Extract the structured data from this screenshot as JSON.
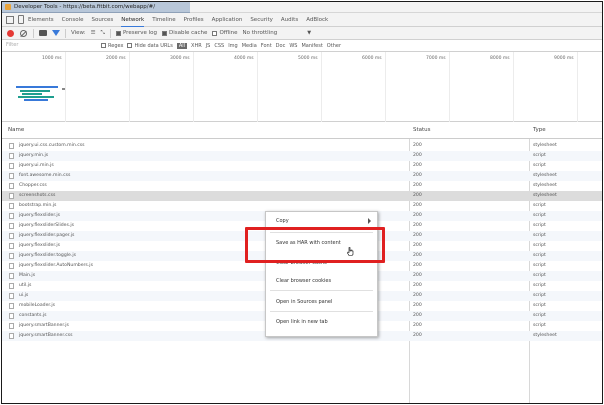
{
  "window": {
    "title": "Developer Tools - https://beta.fitbit.com/webapp/#/"
  },
  "tabs": [
    "Elements",
    "Console",
    "Sources",
    "Network",
    "Timeline",
    "Profiles",
    "Application",
    "Security",
    "Audits",
    "AdBlock"
  ],
  "active_tab": "Network",
  "controls": {
    "view_label": "View:",
    "preserve_log": "Preserve log",
    "disable_cache": "Disable cache",
    "offline": "Offline",
    "throttling": "No throttling"
  },
  "filter": {
    "placeholder": "Filter",
    "regex": "Regex",
    "hide_data_urls": "Hide data URLs",
    "types": [
      "All",
      "XHR",
      "JS",
      "CSS",
      "Img",
      "Media",
      "Font",
      "Doc",
      "WS",
      "Manifest",
      "Other"
    ]
  },
  "timeline": {
    "ticks": [
      "1000 ms",
      "2000 ms",
      "3000 ms",
      "4000 ms",
      "5000 ms",
      "6000 ms",
      "7000 ms",
      "8000 ms",
      "9000 ms"
    ]
  },
  "table": {
    "headers": {
      "name": "Name",
      "status": "Status",
      "type": "Type"
    },
    "rows": [
      {
        "name": "jquery.ui.css.custom.min.css",
        "status": "200",
        "type": "stylesheet"
      },
      {
        "name": "jquery.min.js",
        "status": "200",
        "type": "script"
      },
      {
        "name": "jquery.ui.min.js",
        "status": "200",
        "type": "script"
      },
      {
        "name": "font.awesome.min.css",
        "status": "200",
        "type": "stylesheet"
      },
      {
        "name": "Chopper.css",
        "status": "200",
        "type": "stylesheet"
      },
      {
        "name": "screenshots.css",
        "status": "200",
        "type": "stylesheet"
      },
      {
        "name": "bootstrap.min.js",
        "status": "200",
        "type": "script"
      },
      {
        "name": "jquery.flexslider.js",
        "status": "200",
        "type": "script"
      },
      {
        "name": "jquery.flexsliderSlides.js",
        "status": "200",
        "type": "script"
      },
      {
        "name": "jquery.flexslider.pager.js",
        "status": "200",
        "type": "script"
      },
      {
        "name": "jquery.flexslider.js",
        "status": "200",
        "type": "script"
      },
      {
        "name": "jquery.flexslider.toggle.js",
        "status": "200",
        "type": "script"
      },
      {
        "name": "jquery.flexslider.AutoNumbers.js",
        "status": "200",
        "type": "script"
      },
      {
        "name": "Main.js",
        "status": "200",
        "type": "script"
      },
      {
        "name": "util.js",
        "status": "200",
        "type": "script"
      },
      {
        "name": "ui.js",
        "status": "200",
        "type": "script"
      },
      {
        "name": "mobileLoader.js",
        "status": "200",
        "type": "script"
      },
      {
        "name": "constants.js",
        "status": "200",
        "type": "script"
      },
      {
        "name": "jquery.smartBanner.js",
        "status": "200",
        "type": "script"
      },
      {
        "name": "jquery.smartBanner.css",
        "status": "200",
        "type": "stylesheet"
      }
    ]
  },
  "context_menu": {
    "items": [
      "Copy",
      "Save as HAR with content",
      "Clear browser cache",
      "Clear browser cookies",
      "Open in Sources panel",
      "Open link in new tab"
    ]
  },
  "colors": {
    "highlight": "#e02020",
    "waterfall_primary": "#1e9e8f",
    "waterfall_secondary": "#3879d9"
  }
}
